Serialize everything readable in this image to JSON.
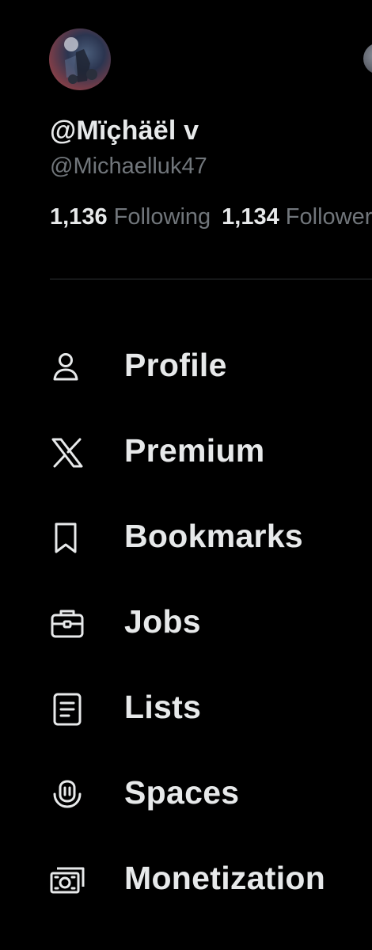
{
  "profile": {
    "display_name": "@Mïçhäël v",
    "handle": "@Michaelluk47",
    "following_count": "1,136",
    "following_label": "Following",
    "followers_count": "1,134",
    "followers_label": "Followers"
  },
  "menu": {
    "items": [
      {
        "label": "Profile",
        "icon": "person-icon"
      },
      {
        "label": "Premium",
        "icon": "x-logo-icon"
      },
      {
        "label": "Bookmarks",
        "icon": "bookmark-icon"
      },
      {
        "label": "Jobs",
        "icon": "briefcase-icon"
      },
      {
        "label": "Lists",
        "icon": "list-icon"
      },
      {
        "label": "Spaces",
        "icon": "spaces-icon"
      },
      {
        "label": "Monetization",
        "icon": "money-icon"
      }
    ]
  },
  "colors": {
    "background": "#000000",
    "primary_text": "#e7e9ea",
    "secondary_text": "#71767b",
    "divider": "#2f3336"
  }
}
